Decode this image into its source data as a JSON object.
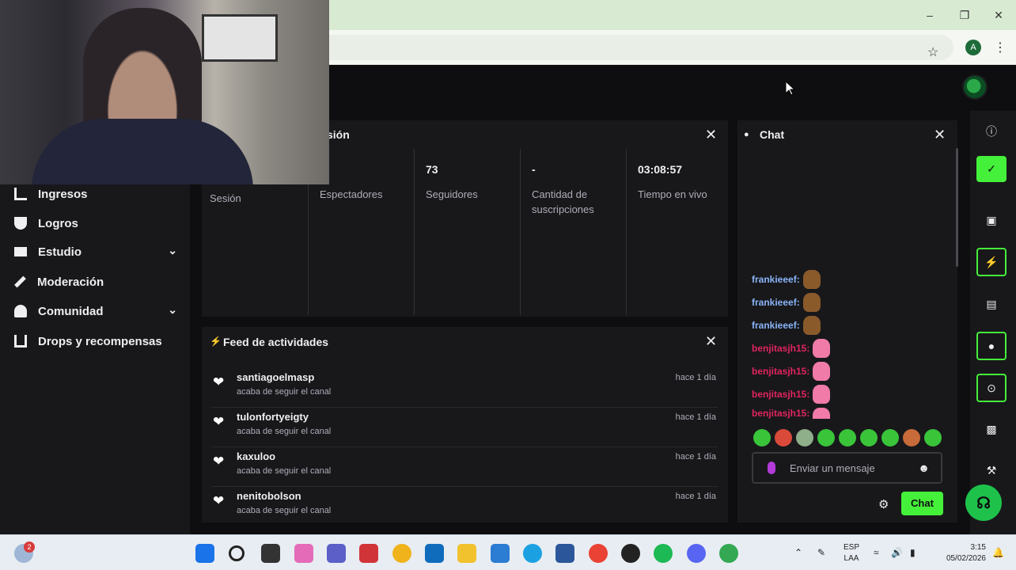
{
  "session": {
    "title_partial": "sión",
    "stats": [
      {
        "value": "",
        "label": "Sesión"
      },
      {
        "value": "",
        "label": "Espectadores"
      },
      {
        "value": "73",
        "label": "Seguidores"
      },
      {
        "value": "-",
        "label": "Cantidad de suscripciones"
      },
      {
        "value": "03:08:57",
        "label": "Tiempo en vivo"
      }
    ]
  },
  "sidebar": {
    "items": [
      {
        "label": "Ingresos",
        "icon": "bar-chart-icon"
      },
      {
        "label": "Logros",
        "icon": "trophy-icon"
      },
      {
        "label": "Estudio",
        "icon": "studio-icon",
        "expandable": true
      },
      {
        "label": "Moderación",
        "icon": "wrench-icon"
      },
      {
        "label": "Comunidad",
        "icon": "community-icon",
        "expandable": true
      },
      {
        "label": "Drops y recompensas",
        "icon": "drops-icon"
      }
    ]
  },
  "feed": {
    "title": "Feed de actividades",
    "items": [
      {
        "user": "santiagoelmasp",
        "desc": "acaba de seguir el canal",
        "time": "hace 1 día"
      },
      {
        "user": "tulonfortyeigty",
        "desc": "acaba de seguir el canal",
        "time": "hace 1 día"
      },
      {
        "user": "kaxuloo",
        "desc": "acaba de seguir el canal",
        "time": "hace 1 día"
      },
      {
        "user": "nenitobolson",
        "desc": "acaba de seguir el canal",
        "time": "hace 1 día"
      }
    ]
  },
  "chat": {
    "title": "Chat",
    "messages": [
      {
        "user": "frankieeef:",
        "color": "#8ab4f8"
      },
      {
        "user": "frankieeef:",
        "color": "#8ab4f8"
      },
      {
        "user": "frankieeef:",
        "color": "#8ab4f8"
      },
      {
        "user": "benjitasjh15:",
        "color": "#e0245e"
      },
      {
        "user": "benjitasjh15:",
        "color": "#e0245e"
      },
      {
        "user": "benjitasjh15:",
        "color": "#e0245e"
      },
      {
        "user": "benjitasjh15:",
        "color": "#e0245e"
      }
    ],
    "input_placeholder": "Enviar un mensaje",
    "send_label": "Chat"
  },
  "browser": {
    "profile_initial": "A"
  },
  "taskbar": {
    "notification_count": "2",
    "lang_line1": "ESP",
    "lang_line2": "LAA",
    "time": "3:15",
    "date": "05/02/2026"
  },
  "colors": {
    "accent": "#45f03a",
    "panel": "#18181b",
    "background": "#0e0e10"
  }
}
